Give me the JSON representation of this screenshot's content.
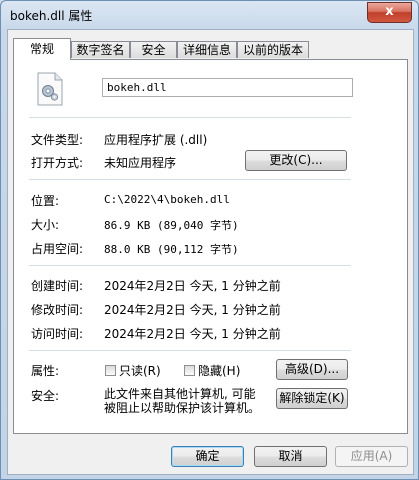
{
  "window": {
    "title": "bokeh.dll 属性",
    "close_symbol": "x"
  },
  "tabs": [
    {
      "label": "常规"
    },
    {
      "label": "数字签名"
    },
    {
      "label": "安全"
    },
    {
      "label": "详细信息"
    },
    {
      "label": "以前的版本"
    }
  ],
  "general": {
    "file_name": "bokeh.dll",
    "file_type_label": "文件类型:",
    "file_type_value": "应用程序扩展 (.dll)",
    "opens_with_label": "打开方式:",
    "opens_with_value": "未知应用程序",
    "change_button": "更改(C)...",
    "location_label": "位置:",
    "location_value": "C:\\2022\\4\\bokeh.dll",
    "size_label": "大小:",
    "size_value": "86.9 KB (89,040 字节)",
    "size_on_disk_label": "占用空间:",
    "size_on_disk_value": "88.0 KB (90,112 字节)",
    "created_label": "创建时间:",
    "created_value": "2024年2月2日 今天, 1 分钟之前",
    "modified_label": "修改时间:",
    "modified_value": "2024年2月2日 今天, 1 分钟之前",
    "accessed_label": "访问时间:",
    "accessed_value": "2024年2月2日 今天, 1 分钟之前",
    "attributes_label": "属性:",
    "readonly_label": "只读(R)",
    "hidden_label": "隐藏(H)",
    "advanced_button": "高级(D)...",
    "security_label": "安全:",
    "security_text_line1": "此文件来自其他计算机, 可能",
    "security_text_line2": "被阻止以帮助保护该计算机。",
    "unblock_button": "解除锁定(K)"
  },
  "footer": {
    "ok": "确定",
    "cancel": "取消",
    "apply": "应用(A)"
  }
}
